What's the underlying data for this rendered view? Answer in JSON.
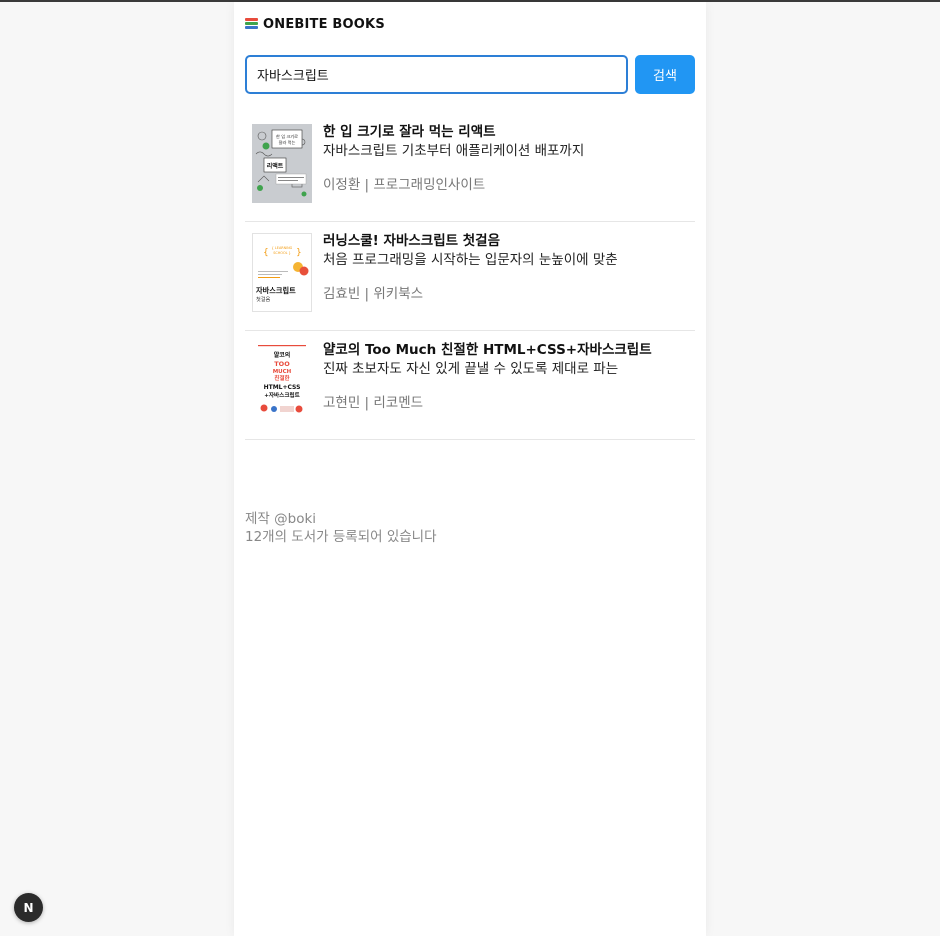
{
  "header": {
    "logo_icon": "books-stack-icon",
    "title": "ONEBITE BOOKS"
  },
  "search": {
    "value": "자바스크립트",
    "button_label": "검색"
  },
  "books": [
    {
      "title": "한 입 크기로 잘라 먹는 리액트",
      "subtitle": "자바스크립트 기초부터 애플리케이션 배포까지",
      "meta": "이정환 | 프로그래밍인사이트",
      "cover": {
        "bg": "#c9ccd0",
        "lines": [
          "한 입 크기로",
          "잘라 먹는",
          "리액트"
        ]
      }
    },
    {
      "title": "러닝스쿨! 자바스크립트 첫걸음",
      "subtitle": "처음 프로그래밍을 시작하는 입문자의 눈높이에 맞춘",
      "meta": "김효빈 | 위키북스",
      "cover": {
        "bg": "#ffffff",
        "lines": [
          "{ LEARNING",
          "SCHOOL }",
          "자바스크립트",
          "첫걸음"
        ]
      }
    },
    {
      "title": "얄코의 Too Much 친절한 HTML+CSS+자바스크립트",
      "subtitle": "진짜 초보자도 자신 있게 끝낼 수 있도록 제대로 파는",
      "meta": "고현민 | 리코멘드",
      "cover": {
        "bg": "#ffffff",
        "lines": [
          "얄코의",
          "TOO",
          "MUCH",
          "친절한",
          "HTML+CSS",
          "+자바스크립트"
        ]
      }
    }
  ],
  "footer": {
    "credit": "제작 @boki",
    "count_text": "12개의 도서가 등록되어 있습니다"
  },
  "dev_badge": {
    "icon": "nextjs-logo-icon",
    "label": "N"
  },
  "colors": {
    "accent": "#2196f3",
    "input_border": "#2d7fd6",
    "page_bg": "#f7f7f7"
  }
}
